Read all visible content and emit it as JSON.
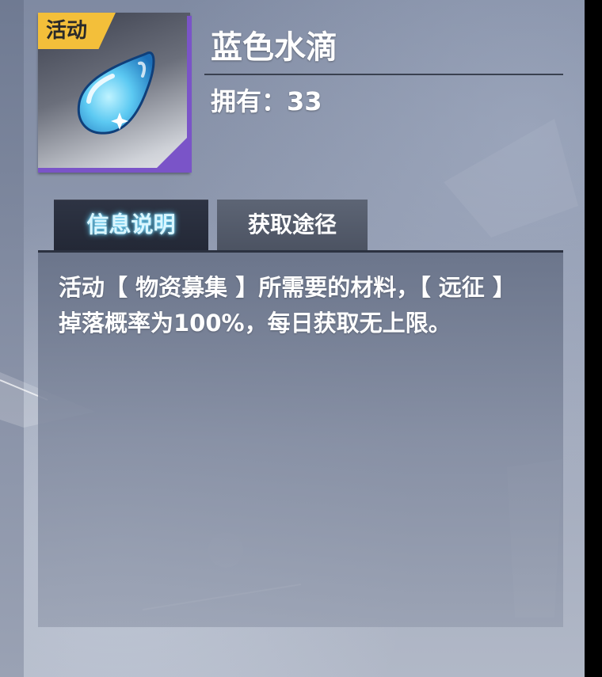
{
  "item": {
    "tag": "活动",
    "name": "蓝色水滴",
    "own_label": "拥有：",
    "own_count": "33",
    "icon": "blue-water-drop-icon",
    "rarity_color": "#7a54c8",
    "tag_color": "#f3bf3a"
  },
  "tabs": [
    {
      "label": "信息说明",
      "active": true
    },
    {
      "label": "获取途径",
      "active": false
    }
  ],
  "description": "活动【 物资募集 】所需要的材料，【 远征 】掉落概率为100%，每日获取无上限。"
}
